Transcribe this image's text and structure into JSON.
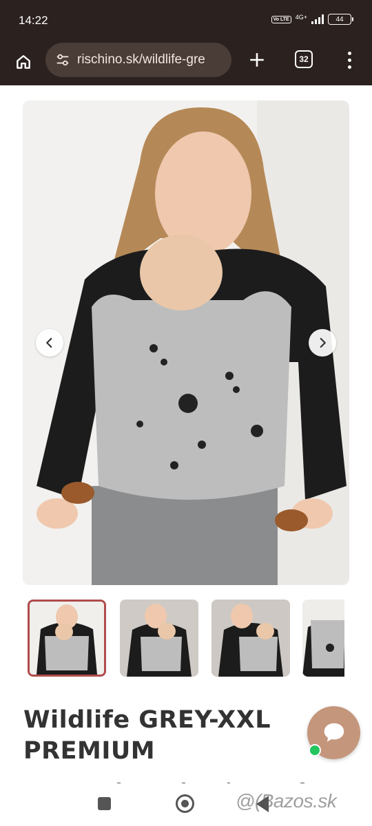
{
  "status_bar": {
    "time": "14:22",
    "volte": "Vo LTE",
    "network": "4G+",
    "battery": "44"
  },
  "browser": {
    "url": "rischino.sk/wildlife-gre",
    "tab_count": "32"
  },
  "icons": [
    "home-icon",
    "tune-icon",
    "plus-icon",
    "tabs-icon",
    "more-vert-icon",
    "chevron-left-icon",
    "chevron-right-icon",
    "chat-icon"
  ],
  "gallery": {
    "thumbnail_count": 4,
    "active_index": 0
  },
  "product": {
    "title": "Wildlife GREY-XXL PREMIUM"
  },
  "watermark": "@(Bazos.sk",
  "colors": {
    "chrome": "#2b211e",
    "url_bar": "#4a3c37",
    "accent_border": "#b04b4b",
    "chat": "#c4967c",
    "online": "#22c55e"
  }
}
